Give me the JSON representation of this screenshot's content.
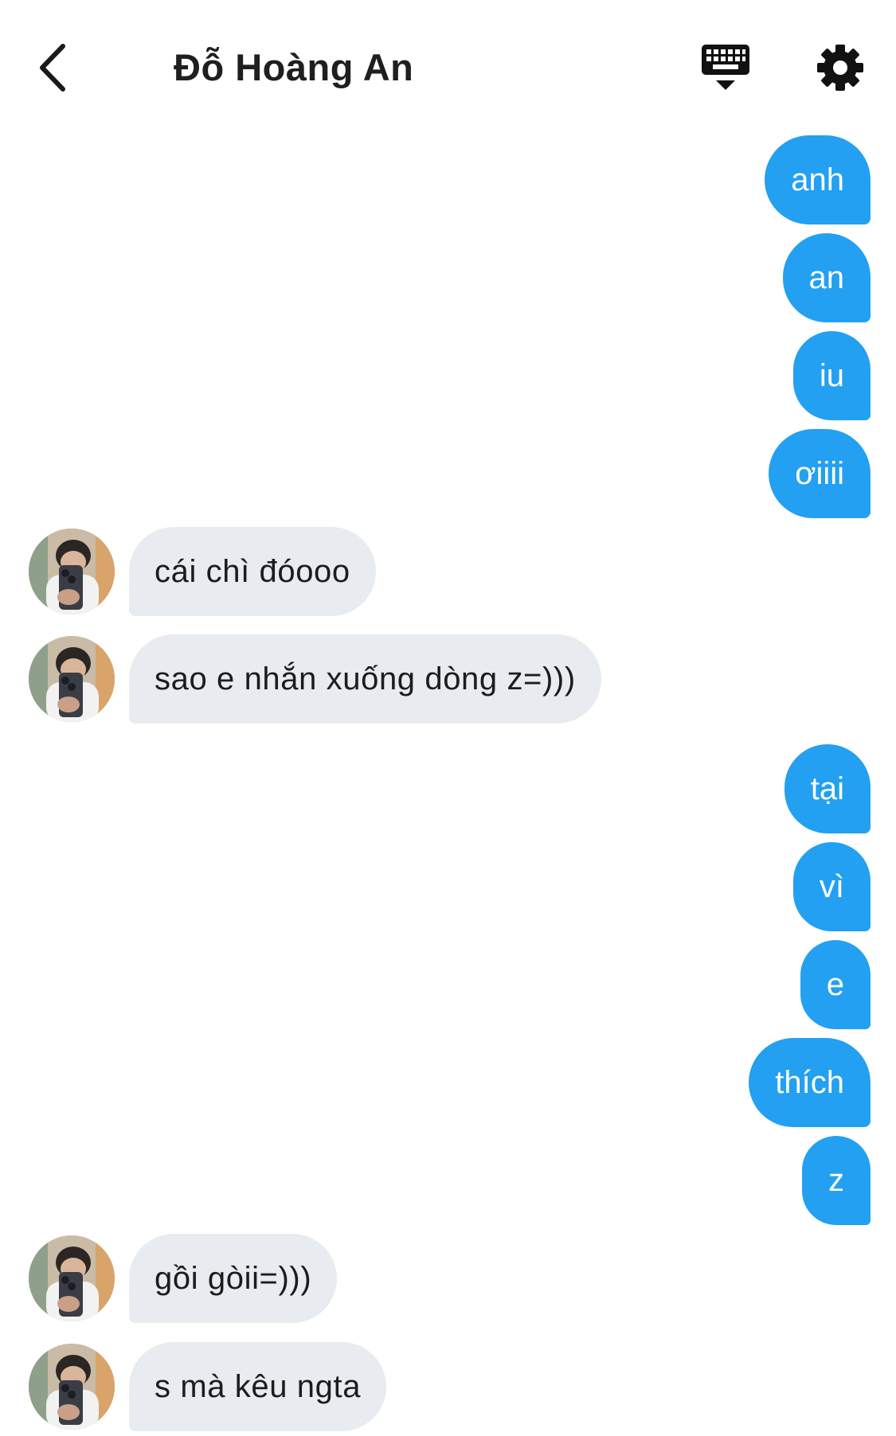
{
  "header": {
    "title": "Đỗ Hoàng An",
    "back_icon": "chevron-left-icon",
    "keyboard_icon": "keyboard-hide-icon",
    "settings_icon": "gear-icon"
  },
  "colors": {
    "outgoing_bubble": "#23a0f1",
    "incoming_bubble": "#e8ebef",
    "title_text": "#1f1f1f"
  },
  "messages": [
    {
      "direction": "outgoing",
      "text": "anh"
    },
    {
      "direction": "outgoing",
      "text": "an"
    },
    {
      "direction": "outgoing",
      "text": "iu"
    },
    {
      "direction": "outgoing",
      "text": "ơiiii"
    },
    {
      "direction": "incoming",
      "text": "cái chì đóooo"
    },
    {
      "direction": "incoming",
      "text": "sao e nhắn xuống dòng z=)))"
    },
    {
      "direction": "outgoing",
      "text": "tại"
    },
    {
      "direction": "outgoing",
      "text": "vì"
    },
    {
      "direction": "outgoing",
      "text": "e"
    },
    {
      "direction": "outgoing",
      "text": "thích"
    },
    {
      "direction": "outgoing",
      "text": "z"
    },
    {
      "direction": "incoming",
      "text": "gồi gòii=)))"
    },
    {
      "direction": "incoming",
      "text": "s mà kêu ngta"
    }
  ]
}
